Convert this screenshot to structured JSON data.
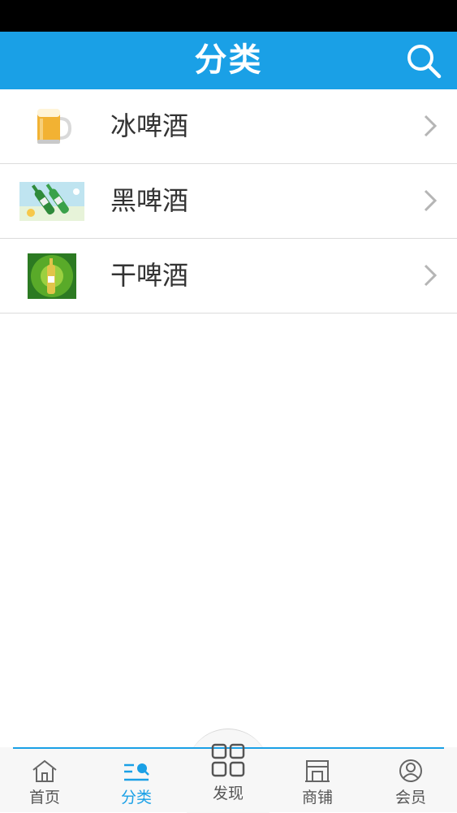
{
  "header": {
    "title": "分类"
  },
  "categories": [
    {
      "label": "冰啤酒",
      "icon": "beer-mug-icon"
    },
    {
      "label": "黑啤酒",
      "icon": "beer-bottles-image"
    },
    {
      "label": "干啤酒",
      "icon": "beer-bottle-poster-image"
    }
  ],
  "bottom_nav": {
    "home": "首页",
    "category": "分类",
    "discover": "发现",
    "shop": "商铺",
    "member": "会员"
  },
  "colors": {
    "accent": "#1aa0e6",
    "status_bar": "#000000"
  }
}
